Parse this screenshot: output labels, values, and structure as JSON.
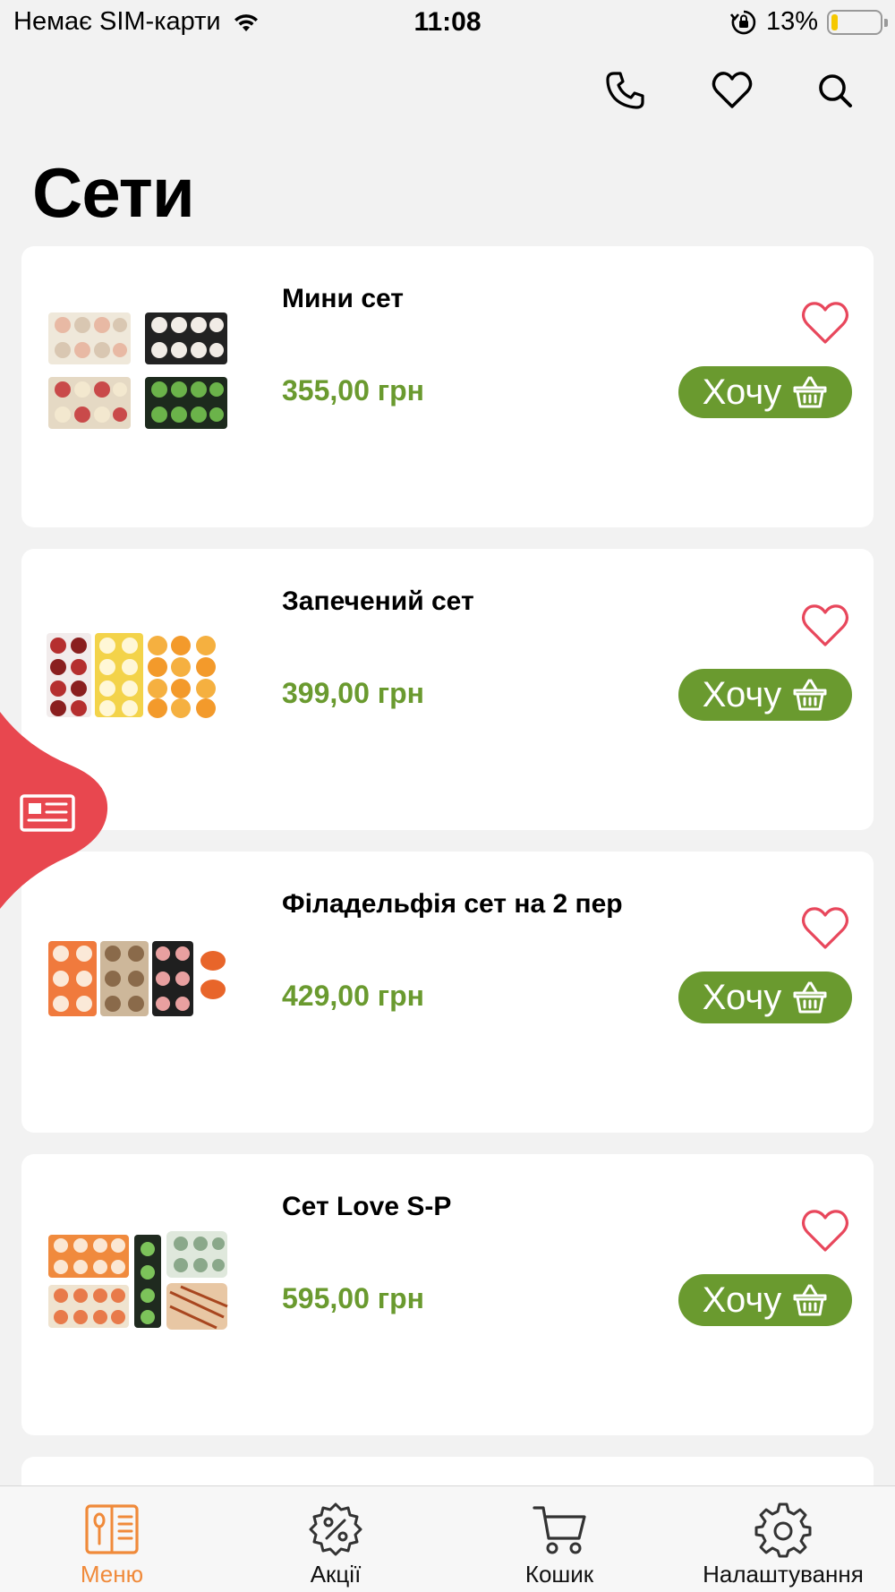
{
  "status": {
    "carrier": "Немає SIM-карти",
    "time": "11:08",
    "battery": "13%",
    "battery_level": 0.13
  },
  "header": {
    "icons": [
      "phone-icon",
      "heart-icon",
      "search-icon"
    ]
  },
  "page_title": "Сети",
  "products": [
    {
      "title": "Мини сет",
      "price": "355,00 грн",
      "buy_label": "Хочу"
    },
    {
      "title": "Запечений сет",
      "price": "399,00 грн",
      "buy_label": "Хочу"
    },
    {
      "title": "Філадельфія сет на 2 пер",
      "price": "429,00 грн",
      "buy_label": "Хочу"
    },
    {
      "title": "Сет Love S-P",
      "price": "595,00 грн",
      "buy_label": "Хочу"
    }
  ],
  "colors": {
    "accent_green": "#6a9a2f",
    "favorite_red": "#e8475c",
    "side_tab_red": "#e8474f",
    "active_tab_orange": "#f08a3a"
  },
  "tabs": [
    {
      "label": "Меню",
      "icon": "menu-book-icon",
      "active": true
    },
    {
      "label": "Акції",
      "icon": "discount-badge-icon",
      "active": false
    },
    {
      "label": "Кошик",
      "icon": "cart-icon",
      "active": false
    },
    {
      "label": "Налаштування",
      "icon": "gear-icon",
      "active": false
    }
  ]
}
